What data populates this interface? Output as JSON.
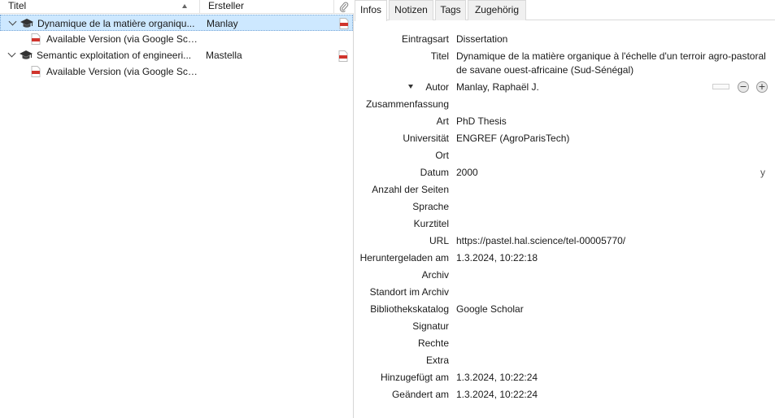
{
  "item_list": {
    "columns": {
      "title": "Titel",
      "creator": "Ersteller"
    },
    "icons": {
      "sort": "sort-ascending-icon",
      "attachment": "paperclip-icon",
      "item_type": "graduation-cap-icon",
      "attachment_type": "pdf-icon"
    },
    "items": [
      {
        "title": "Dynamique de la matière organiqu...",
        "creator": "Manlay",
        "selected": true,
        "attachment": "Available Version (via Google Sch..."
      },
      {
        "title": "Semantic exploitation of engineeri...",
        "creator": "Mastella",
        "selected": false,
        "attachment": "Available Version (via Google Sch..."
      }
    ]
  },
  "item_pane": {
    "tabs": [
      "Infos",
      "Notizen",
      "Tags",
      "Zugehörig"
    ],
    "active_tab": "Infos",
    "fields": {
      "item_type": {
        "label": "Eintragsart",
        "value": "Dissertation"
      },
      "title": {
        "label": "Titel",
        "value": "Dynamique de la matière organique à l'échelle d'un terroir agro-pastoral de savane ouest-africaine (Sud-Sénégal)"
      },
      "author": {
        "label": "Autor",
        "value": "Manlay, Raphaël J."
      },
      "abstract": {
        "label": "Zusammenfassung",
        "value": ""
      },
      "type": {
        "label": "Art",
        "value": "PhD Thesis"
      },
      "university": {
        "label": "Universität",
        "value": "ENGREF (AgroParisTech)"
      },
      "place": {
        "label": "Ort",
        "value": ""
      },
      "date": {
        "label": "Datum",
        "value": "2000",
        "format_hint": "y"
      },
      "pages": {
        "label": "Anzahl der Seiten",
        "value": ""
      },
      "language": {
        "label": "Sprache",
        "value": ""
      },
      "short_title": {
        "label": "Kurztitel",
        "value": ""
      },
      "url": {
        "label": "URL",
        "value": "https://pastel.hal.science/tel-00005770/"
      },
      "accessed": {
        "label": "Heruntergeladen am",
        "value": "1.3.2024, 10:22:18"
      },
      "archive": {
        "label": "Archiv",
        "value": ""
      },
      "archive_location": {
        "label": "Standort im Archiv",
        "value": ""
      },
      "library_catalog": {
        "label": "Bibliothekskatalog",
        "value": "Google Scholar"
      },
      "call_number": {
        "label": "Signatur",
        "value": ""
      },
      "rights": {
        "label": "Rechte",
        "value": ""
      },
      "extra": {
        "label": "Extra",
        "value": ""
      },
      "date_added": {
        "label": "Hinzugefügt am",
        "value": "1.3.2024, 10:22:24"
      },
      "date_modified": {
        "label": "Geändert am",
        "value": "1.3.2024, 10:22:24"
      }
    },
    "author_controls": {
      "remove": "−",
      "add": "+"
    }
  },
  "colors": {
    "selection": "#cde8ff",
    "tab_inactive": "#f0f0f0",
    "pdf_red": "#d0342c",
    "cap_dark": "#333333"
  }
}
